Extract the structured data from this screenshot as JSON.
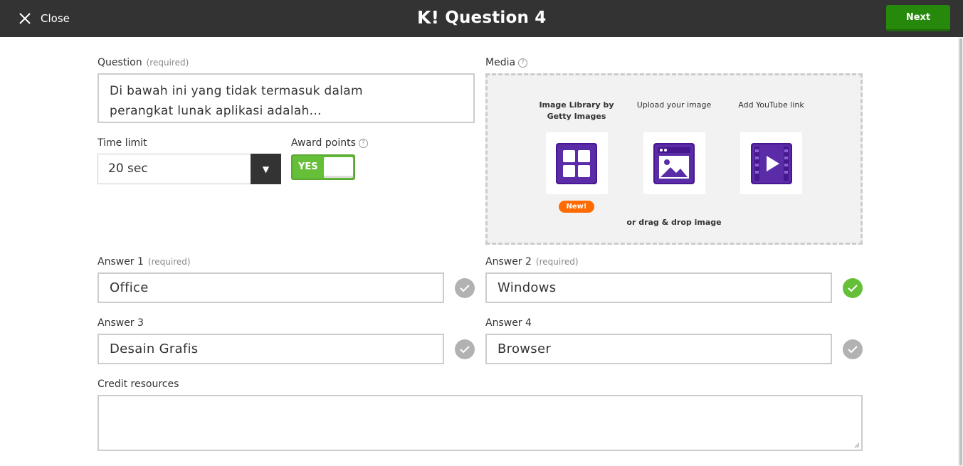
{
  "topbar": {
    "close_label": "Close",
    "logo": "K!",
    "title": "Question 4",
    "next_label": "Next"
  },
  "question": {
    "label": "Question",
    "required": "(required)",
    "text_line1": "Di bawah ini yang tidak termasuk dalam",
    "text_line2": "perangkat lunak aplikasi adalah..."
  },
  "time_limit": {
    "label": "Time limit",
    "value": "20 sec"
  },
  "award_points": {
    "label": "Award points",
    "toggle_label": "YES"
  },
  "media": {
    "label": "Media",
    "options": [
      {
        "line1": "Image Library by",
        "line2": "Getty Images",
        "icon": "image-library-icon"
      },
      {
        "line1": "Upload your image",
        "line2": "",
        "icon": "upload-image-icon"
      },
      {
        "line1": "Add YouTube link",
        "line2": "",
        "icon": "youtube-video-icon"
      }
    ],
    "new_badge": "New!",
    "drag_drop": "or drag & drop image"
  },
  "answers": [
    {
      "label": "Answer 1",
      "required": "(required)",
      "value": "Office",
      "correct": false
    },
    {
      "label": "Answer 2",
      "required": "(required)",
      "value": "Windows",
      "correct": true
    },
    {
      "label": "Answer 3",
      "required": "",
      "value": "Desain Grafis",
      "correct": false
    },
    {
      "label": "Answer 4",
      "required": "",
      "value": "Browser",
      "correct": false
    }
  ],
  "credit": {
    "label": "Credit resources",
    "value": ""
  },
  "colors": {
    "topbar": "#333333",
    "next_button": "#26890c",
    "toggle_on": "#66bf39",
    "correct_check": "#66bf39",
    "unchecked": "#b2b2b2",
    "media_icon": "#46178f",
    "new_badge": "#ff6b00"
  }
}
